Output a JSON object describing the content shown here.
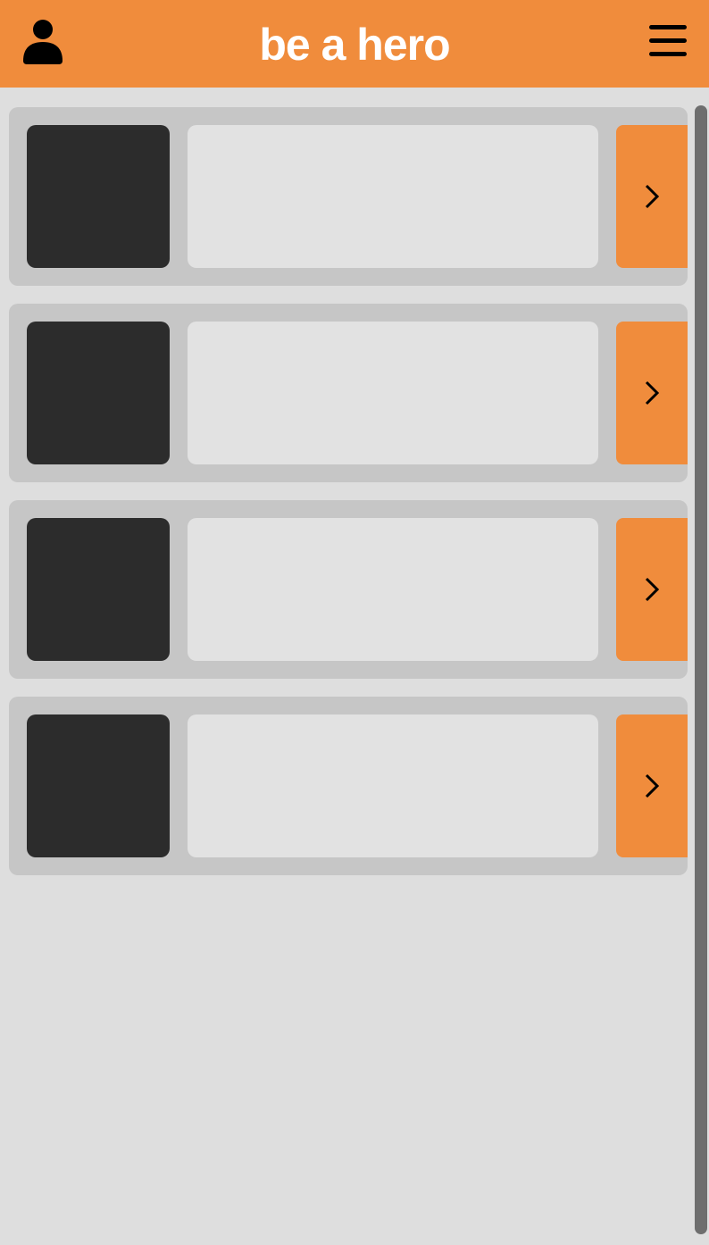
{
  "header": {
    "title": "be a hero",
    "user_icon": "user-icon",
    "menu_icon": "hamburger-menu-icon",
    "background_color": "#f08c3c",
    "title_color": "#ffffff"
  },
  "cards": [
    {
      "thumbnail": "",
      "content": "",
      "action_icon": "chevron-right-icon"
    },
    {
      "thumbnail": "",
      "content": "",
      "action_icon": "chevron-right-icon"
    },
    {
      "thumbnail": "",
      "content": "",
      "action_icon": "chevron-right-icon"
    },
    {
      "thumbnail": "",
      "content": "",
      "action_icon": "chevron-right-icon"
    }
  ],
  "colors": {
    "page_background": "#dedede",
    "card_background": "#c6c6c6",
    "thumbnail": "#2c2c2c",
    "card_body": "#e2e2e2",
    "accent": "#f08c3c",
    "scrollbar": "#6e6e6e"
  }
}
